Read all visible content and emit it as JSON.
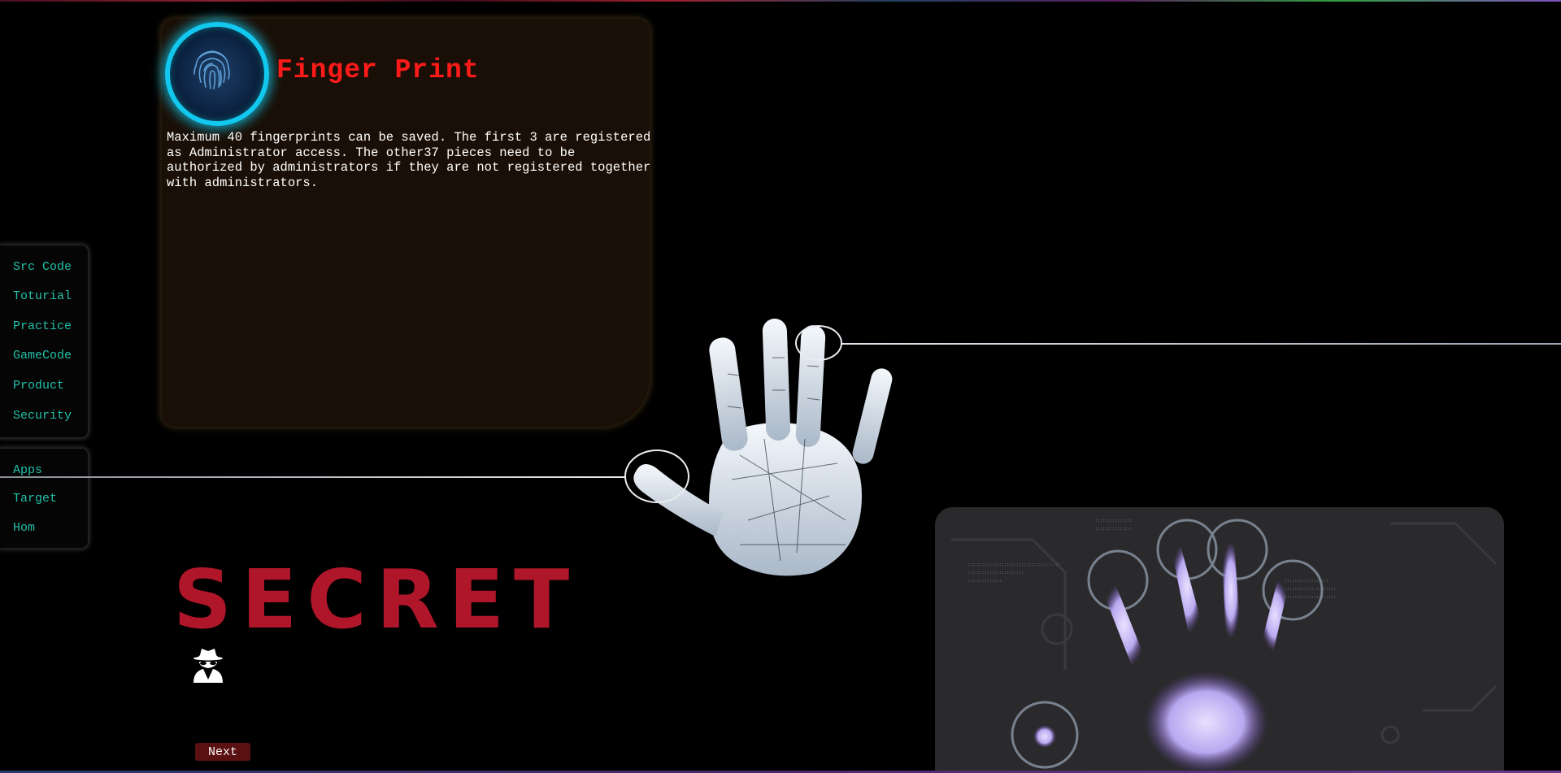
{
  "card": {
    "title": "Finger Print",
    "description": "Maximum 40 fingerprints can be saved. The first 3 are registered as Administrator access. The other37 pieces need to be authorized by administrators if they are not registered together with administrators."
  },
  "nav": {
    "primary": [
      "Src Code",
      "Toturial",
      "Practice",
      "GameCode",
      "Product",
      "Security"
    ],
    "secondary": [
      "Apps",
      "Target",
      "Hom"
    ]
  },
  "banner": {
    "text": "SECRET"
  },
  "next_button": {
    "label": "Next"
  },
  "colors": {
    "title": "#ff1a1a",
    "nav_text": "#20c0a8",
    "secret": "#b0162a",
    "badge_ring": "#12c8ee",
    "card_bg": "#1a0f06",
    "next_bg": "#5a1010"
  },
  "icons": [
    "fingerprint-icon",
    "spy-icon",
    "handprint-image",
    "palm-scan-image"
  ]
}
